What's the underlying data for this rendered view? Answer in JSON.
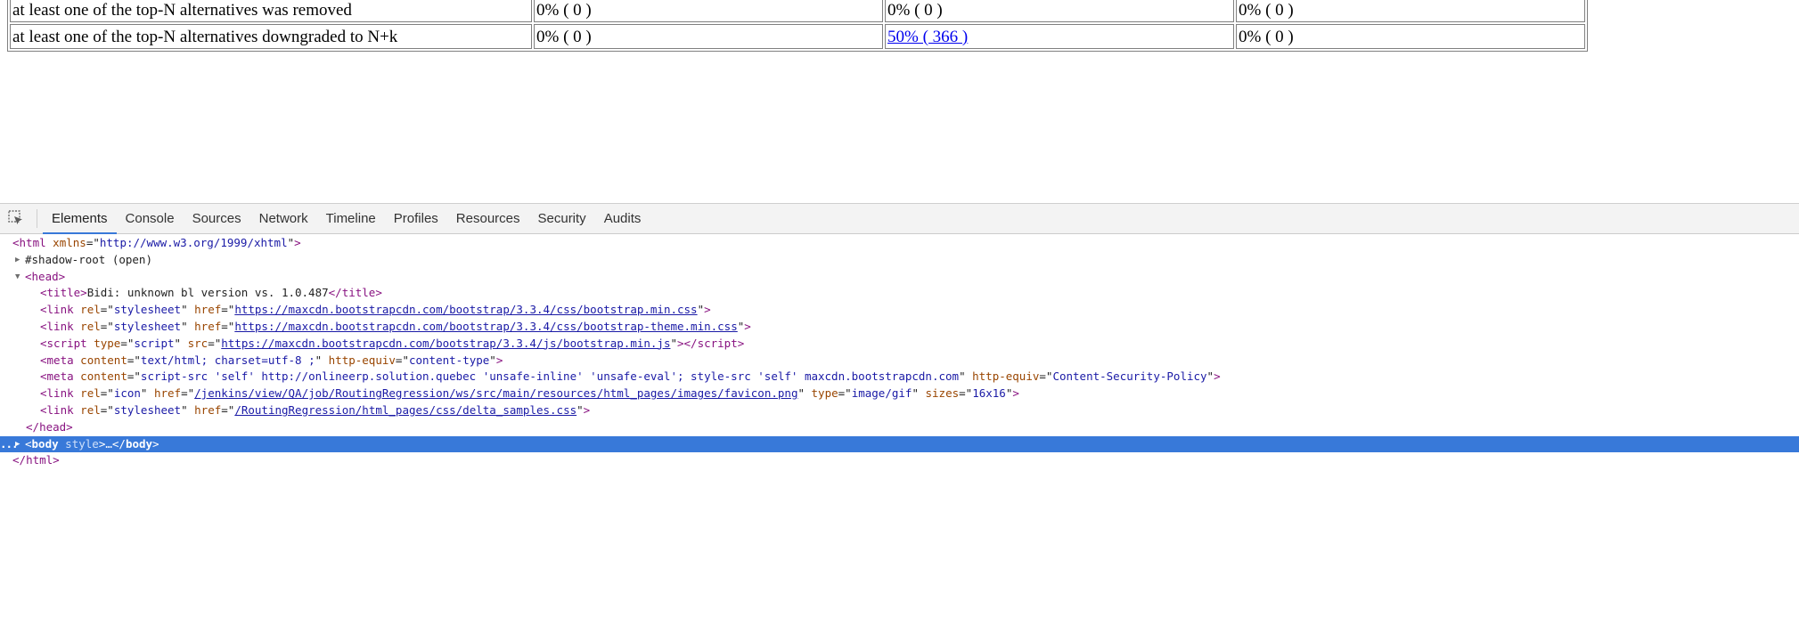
{
  "table": {
    "rows": [
      {
        "label": "at least one of the top-N alternatives was removed",
        "cells": [
          {
            "text": "0% ( 0 )",
            "link": false
          },
          {
            "text": "0% ( 0 )",
            "link": false
          },
          {
            "text": "0% ( 0 )",
            "link": false
          }
        ]
      },
      {
        "label": "at least one of the top-N alternatives downgraded to N+k",
        "cells": [
          {
            "text": "0% ( 0 )",
            "link": false
          },
          {
            "text": "50% ( 366 )",
            "link": true
          },
          {
            "text": "0% ( 0 )",
            "link": false
          }
        ]
      }
    ]
  },
  "devtools": {
    "tabs": [
      "Elements",
      "Console",
      "Sources",
      "Network",
      "Timeline",
      "Profiles",
      "Resources",
      "Security",
      "Audits"
    ],
    "active_tab": "Elements",
    "inspect_icon": "inspect-element-icon",
    "selection_color": "#3879d9",
    "dom": {
      "html_open": {
        "tag": "html",
        "attr": "xmlns",
        "value": "http://www.w3.org/1999/xhtml"
      },
      "shadow_root": "#shadow-root (open)",
      "head_tag": "head",
      "title_tag": "title",
      "title_text": "Bidi: unknown bl version vs. 1.0.487",
      "link_tag": "link",
      "script_tag": "script",
      "meta_tag": "meta",
      "body_tag": "body",
      "attr_rel": "rel",
      "attr_href": "href",
      "attr_type": "type",
      "attr_src": "src",
      "attr_content": "content",
      "attr_http_equiv": "http-equiv",
      "attr_sizes": "sizes",
      "attr_style": "style",
      "val_stylesheet": "stylesheet",
      "val_icon": "icon",
      "val_script": "script",
      "bootstrap_css": "https://maxcdn.bootstrapcdn.com/bootstrap/3.3.4/css/bootstrap.min.css",
      "bootstrap_theme_css": "https://maxcdn.bootstrapcdn.com/bootstrap/3.3.4/css/bootstrap-theme.min.css",
      "bootstrap_js": "https://maxcdn.bootstrapcdn.com/bootstrap/3.3.4/js/bootstrap.min.js",
      "meta1_content": "text/html; charset=utf-8 ;",
      "meta1_equiv": "content-type",
      "meta2_content": "script-src 'self' http://onlineerp.solution.quebec 'unsafe-inline' 'unsafe-eval'; style-src 'self' maxcdn.bootstrapcdn.com",
      "meta2_equiv": "Content-Security-Policy",
      "favicon_href": "/jenkins/view/QA/job/RoutingRegression/ws/src/main/resources/html_pages/images/favicon.png",
      "favicon_type": "image/gif",
      "favicon_sizes": "16x16",
      "delta_css": "/RoutingRegression/html_pages/css/delta_samples.css",
      "body_ellipsis": "…",
      "dots": "..."
    }
  }
}
